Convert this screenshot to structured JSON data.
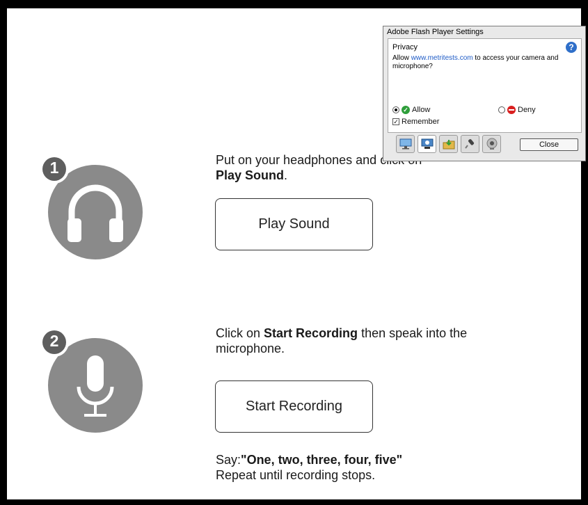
{
  "flash_dialog": {
    "title": "Adobe Flash Player Settings",
    "section": "Privacy",
    "help_icon": "question-icon",
    "message_prefix": "Allow ",
    "message_link": "www.metritests.com",
    "message_suffix": " to access your camera and microphone?",
    "allow_label": "Allow",
    "deny_label": "Deny",
    "remember_label": "Remember",
    "selected_option": "Allow",
    "remember_checked": true,
    "close_label": "Close",
    "tabs": [
      "display-icon",
      "privacy-icon",
      "storage-icon",
      "microphone-icon",
      "camera-icon"
    ]
  },
  "steps": [
    {
      "number": "1",
      "icon": "headphones-icon",
      "text_before": "Put on your headphones and click on ",
      "text_bold": "Play Sound",
      "text_after": ".",
      "button_label": "Play Sound"
    },
    {
      "number": "2",
      "icon": "microphone-icon",
      "text_before": "Click on ",
      "text_bold": "Start Recording",
      "text_after": " then speak into the microphone.",
      "button_label": "Start Recording",
      "say_prefix": "Say:",
      "say_bold": "\"One, two, three, four, five\"",
      "repeat_text": "Repeat until recording stops."
    }
  ],
  "colors": {
    "icon_gray": "#8a8a8a",
    "badge_gray": "#5e5e5e",
    "link_blue": "#1e5bc6"
  }
}
